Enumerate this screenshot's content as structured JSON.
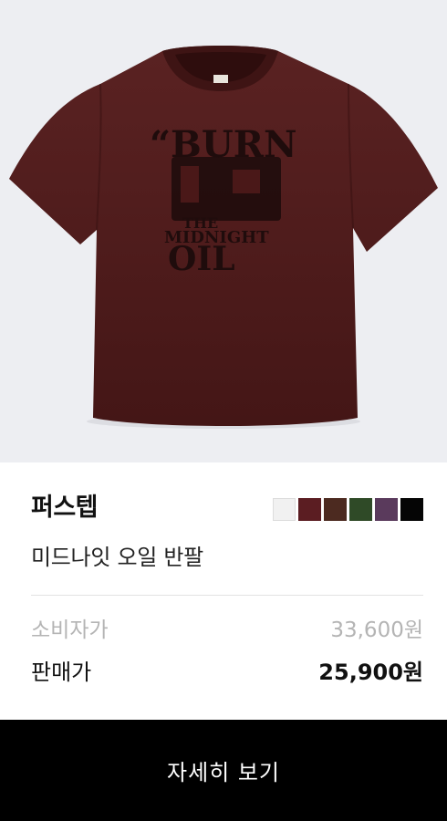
{
  "product": {
    "brand": "퍼스텝",
    "name": "미드나잇 오일 반팔",
    "image": "maroon-tshirt-burn-the-midnight-oil-print",
    "print_text": [
      "“BURN",
      "THE",
      "MIDNIGHT",
      "OIL"
    ],
    "shirt_color": "#4f1c1c"
  },
  "colors": [
    "#f1f1f1",
    "#5b1d22",
    "#4c2a20",
    "#2f4a27",
    "#5a3a5c",
    "#050505"
  ],
  "price": {
    "retail_label": "소비자가",
    "retail_value": "33,600원",
    "sale_label": "판매가",
    "sale_value": "25,900원"
  },
  "cta": {
    "label": "자세히 보기"
  }
}
